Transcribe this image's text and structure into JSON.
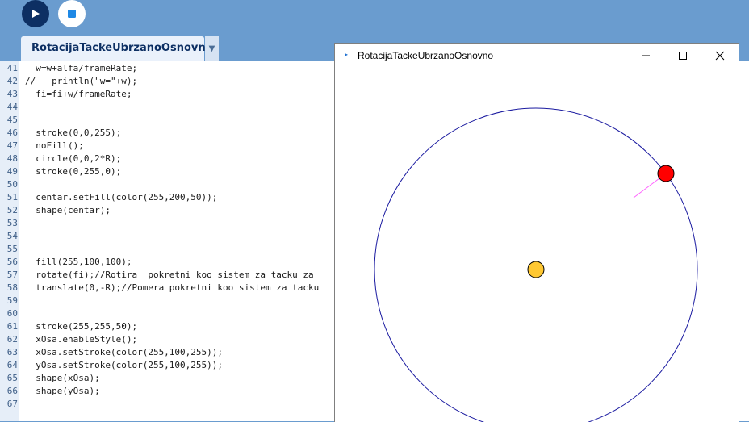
{
  "toolbar": {
    "run_icon": "play-icon",
    "stop_icon": "stop-icon"
  },
  "tab": {
    "label": "RotacijaTackeUbrzanoOsnovno",
    "dropdown_icon": "chevron-down-icon"
  },
  "editor": {
    "lines": [
      {
        "num": "41",
        "code": "  w=w+alfa/frameRate;"
      },
      {
        "num": "42",
        "code": "//   println(\"w=\"+w);"
      },
      {
        "num": "43",
        "code": "  fi=fi+w/frameRate;"
      },
      {
        "num": "44",
        "code": ""
      },
      {
        "num": "45",
        "code": ""
      },
      {
        "num": "46",
        "code": "  stroke(0,0,255);"
      },
      {
        "num": "47",
        "code": "  noFill();"
      },
      {
        "num": "48",
        "code": "  circle(0,0,2*R);"
      },
      {
        "num": "49",
        "code": "  stroke(0,255,0);"
      },
      {
        "num": "50",
        "code": ""
      },
      {
        "num": "51",
        "code": "  centar.setFill(color(255,200,50));"
      },
      {
        "num": "52",
        "code": "  shape(centar);"
      },
      {
        "num": "53",
        "code": ""
      },
      {
        "num": "54",
        "code": ""
      },
      {
        "num": "55",
        "code": ""
      },
      {
        "num": "56",
        "code": "  fill(255,100,100);"
      },
      {
        "num": "57",
        "code": "  rotate(fi);//Rotira  pokretni koo sistem za tacku za"
      },
      {
        "num": "58",
        "code": "  translate(0,-R);//Pomera pokretni koo sistem za tacku"
      },
      {
        "num": "59",
        "code": ""
      },
      {
        "num": "60",
        "code": ""
      },
      {
        "num": "61",
        "code": "  stroke(255,255,50);"
      },
      {
        "num": "62",
        "code": "  xOsa.enableStyle();"
      },
      {
        "num": "63",
        "code": "  xOsa.setStroke(color(255,100,255));"
      },
      {
        "num": "64",
        "code": "  yOsa.setStroke(color(255,100,255));"
      },
      {
        "num": "65",
        "code": "  shape(xOsa);"
      },
      {
        "num": "66",
        "code": "  shape(yOsa);"
      },
      {
        "num": "67",
        "code": ""
      }
    ]
  },
  "sketch_window": {
    "title": "RotacijaTackeUbrzanoOsnovno",
    "minimize_icon": "minimize-icon",
    "maximize_icon": "maximize-icon",
    "close_icon": "close-icon"
  },
  "colors": {
    "ide_blue": "#6a9ccf",
    "orbit_stroke": "#1a1aa0",
    "center_fill": "#ffc832",
    "point_fill": "#ff0000",
    "axis_stroke": "#ff64ff"
  }
}
